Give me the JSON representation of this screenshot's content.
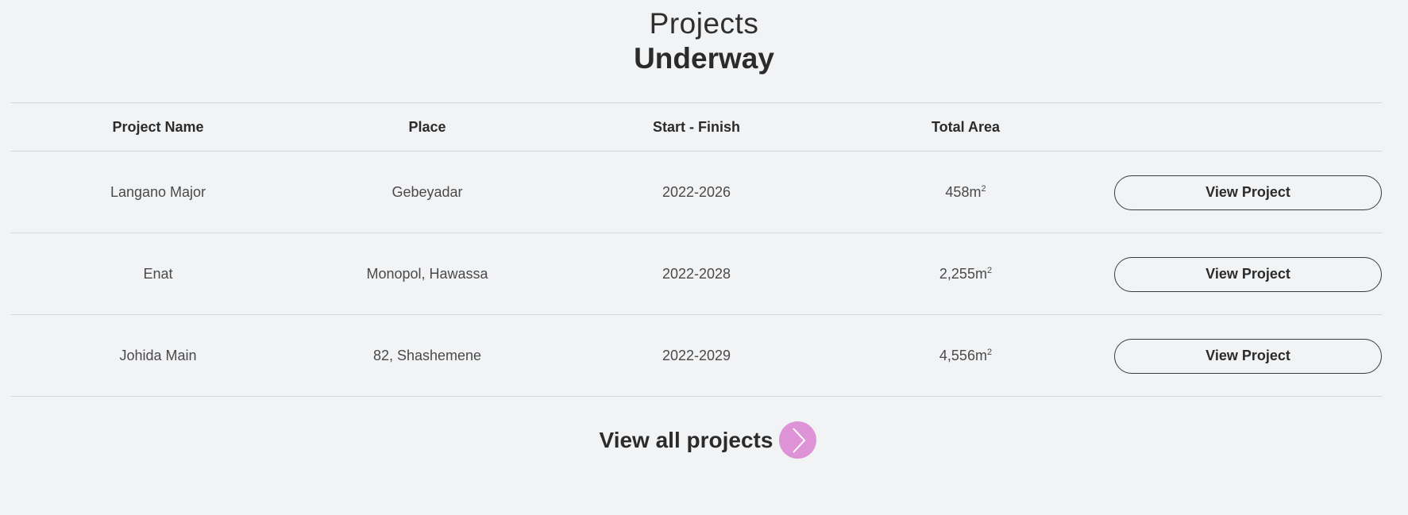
{
  "heading": {
    "line1": "Projects",
    "line2": "Underway"
  },
  "table": {
    "columns": [
      "Project Name",
      "Place",
      "Start - Finish",
      "Total Area"
    ],
    "rows": [
      {
        "name": "Langano Major",
        "place": "Gebeyadar",
        "period": "2022-2026",
        "area": "458m",
        "area_unit_sup": "2",
        "button": "View Project"
      },
      {
        "name": "Enat",
        "place": "Monopol, Hawassa",
        "period": "2022-2028",
        "area": "2,255m",
        "area_unit_sup": "2",
        "button": "View Project"
      },
      {
        "name": "Johida Main",
        "place": "82, Shashemene",
        "period": "2022-2029",
        "area": "4,556m",
        "area_unit_sup": "2",
        "button": "View Project"
      }
    ]
  },
  "footer": {
    "view_all_label": "View all projects",
    "arrow_icon": "chevron-right-icon",
    "accent_color": "#de93d6"
  }
}
